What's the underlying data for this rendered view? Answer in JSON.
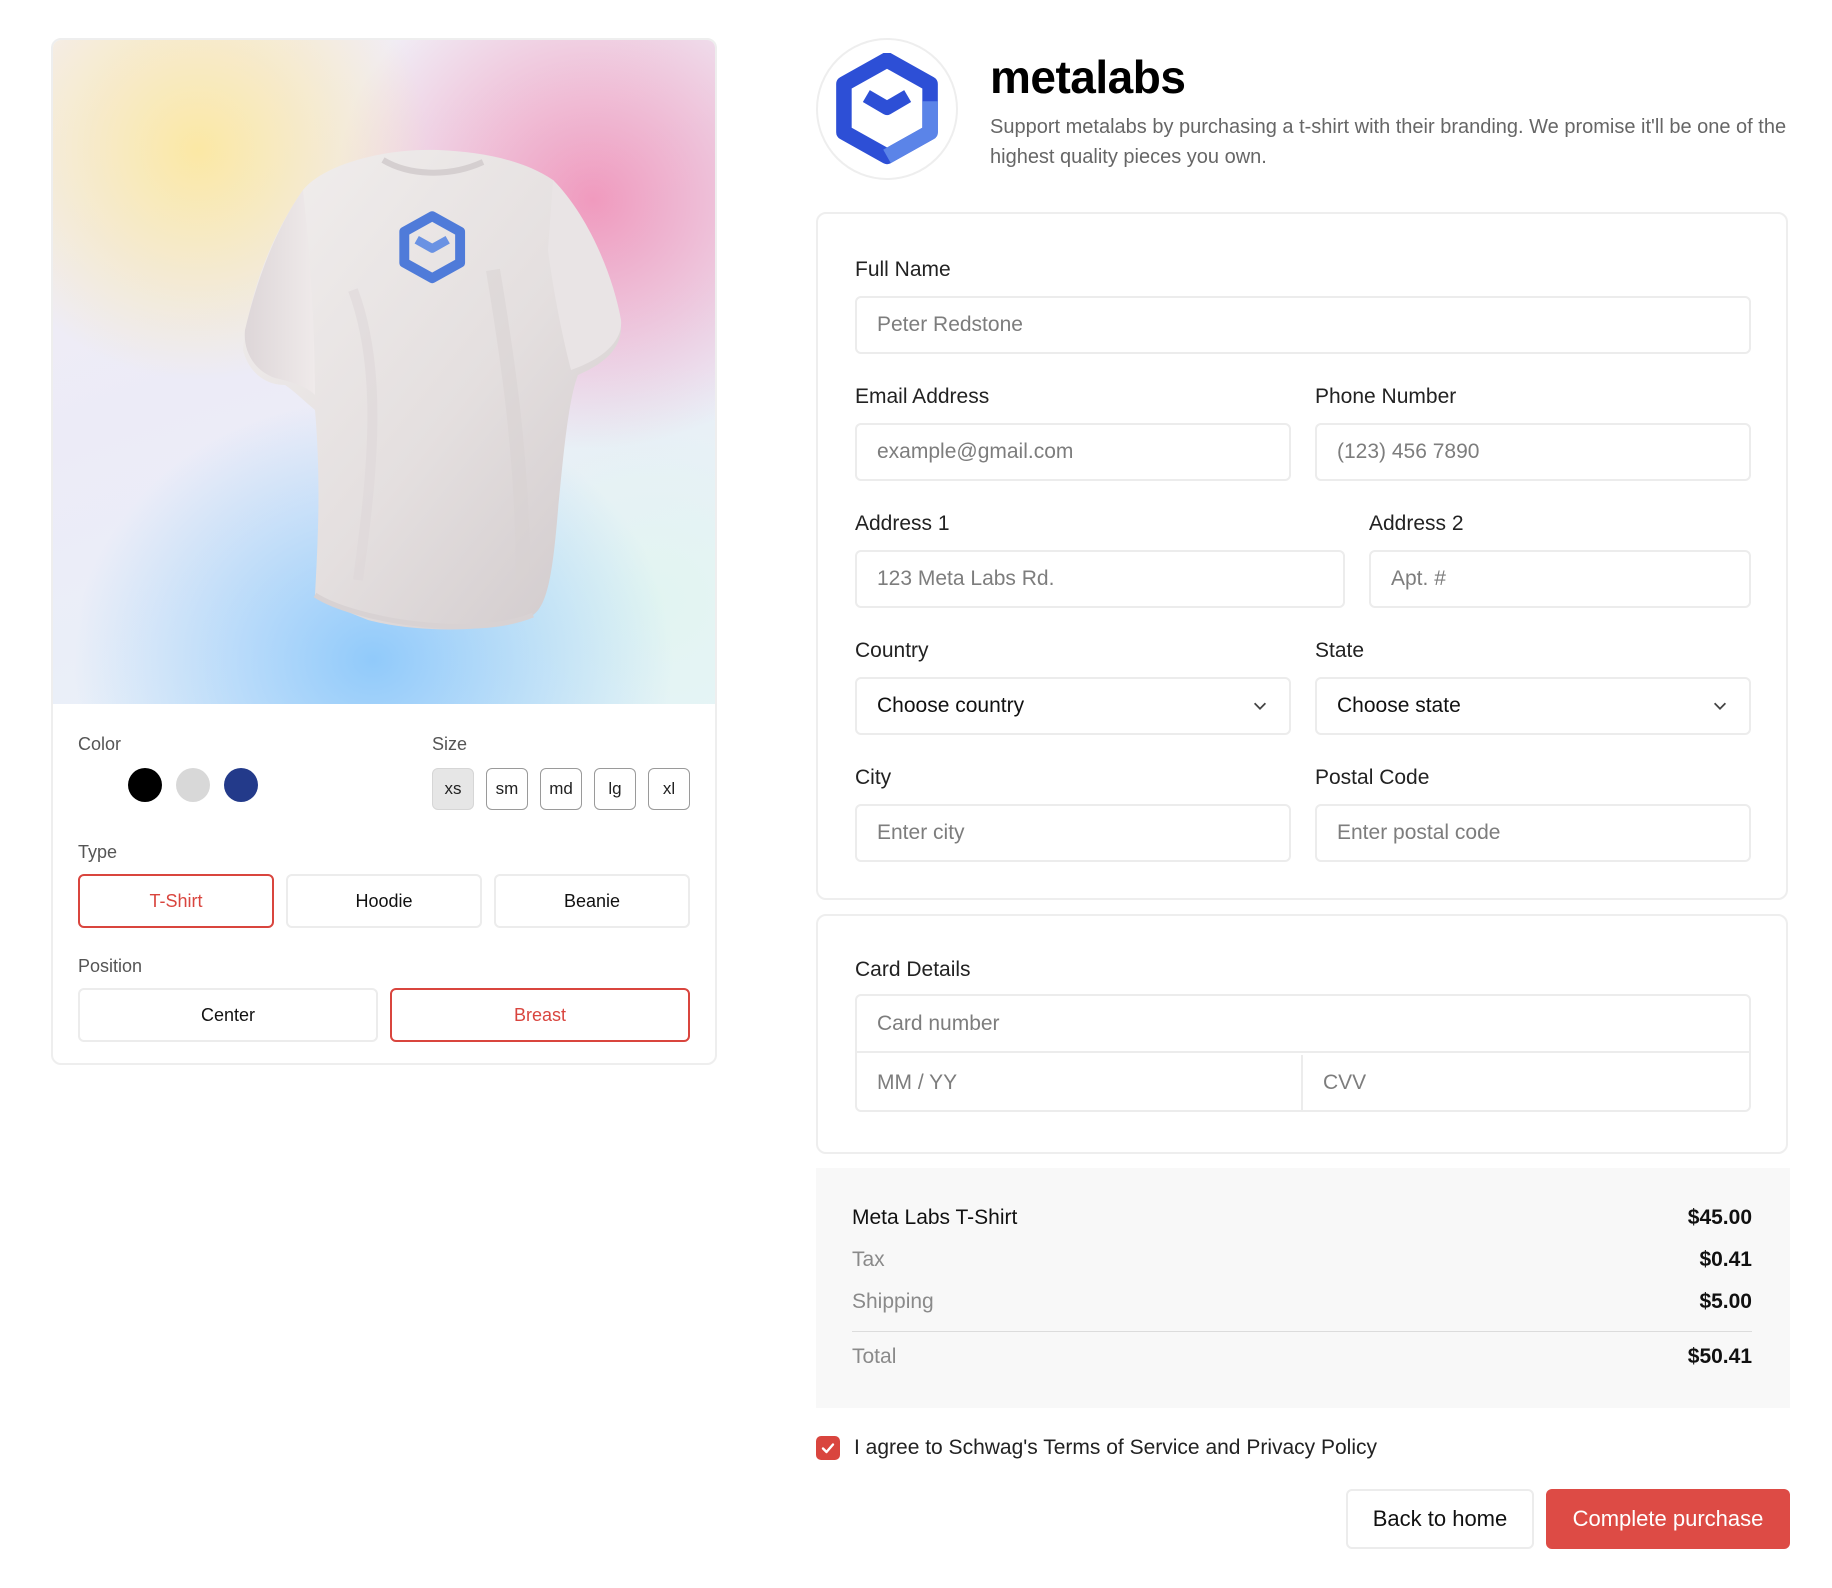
{
  "brand": {
    "name": "metalabs",
    "description": "Support metalabs by purchasing a t-shirt with their branding. We promise it'll be one of the highest quality pieces you own.",
    "logo_icon": "metalabs-hexagon-logo",
    "logo_colors": [
      "#2d4fd6",
      "#5b84e8"
    ]
  },
  "product": {
    "image_icon": "tshirt-mockup",
    "color_label": "Color",
    "colors": [
      {
        "name": "black",
        "hex": "#000000"
      },
      {
        "name": "light-gray",
        "hex": "#d8d8d8"
      },
      {
        "name": "navy",
        "hex": "#233a8a"
      }
    ],
    "size_label": "Size",
    "sizes": [
      "xs",
      "sm",
      "md",
      "lg",
      "xl"
    ],
    "selected_size": "xs",
    "type_label": "Type",
    "types": [
      "T-Shirt",
      "Hoodie",
      "Beanie"
    ],
    "selected_type": "T-Shirt",
    "position_label": "Position",
    "positions": [
      "Center",
      "Breast"
    ],
    "selected_position": "Breast"
  },
  "form": {
    "full_name_label": "Full Name",
    "full_name_placeholder": "Peter Redstone",
    "email_label": "Email Address",
    "email_placeholder": "example@gmail.com",
    "phone_label": "Phone Number",
    "phone_placeholder": "(123) 456 7890",
    "address1_label": "Address 1",
    "address1_placeholder": "123 Meta Labs Rd.",
    "address2_label": "Address 2",
    "address2_placeholder": "Apt. #",
    "country_label": "Country",
    "country_value": "Choose country",
    "state_label": "State",
    "state_value": "Choose state",
    "city_label": "City",
    "city_placeholder": "Enter city",
    "postal_label": "Postal Code",
    "postal_placeholder": "Enter postal code"
  },
  "card": {
    "title": "Card Details",
    "number_placeholder": "Card number",
    "expiry_placeholder": "MM / YY",
    "cvv_placeholder": "CVV"
  },
  "summary": {
    "item_label": "Meta Labs T-Shirt",
    "item_price": "$45.00",
    "tax_label": "Tax",
    "tax_value": "$0.41",
    "shipping_label": "Shipping",
    "shipping_value": "$5.00",
    "total_label": "Total",
    "total_value": "$50.41"
  },
  "agreement": {
    "text": "I agree to Schwag's Terms of Service and Privacy Policy",
    "checked": true
  },
  "actions": {
    "back_label": "Back to home",
    "complete_label": "Complete purchase"
  },
  "colors": {
    "accent": "#d9453e",
    "border": "#ececec",
    "summary_bg": "#f8f8f8"
  }
}
